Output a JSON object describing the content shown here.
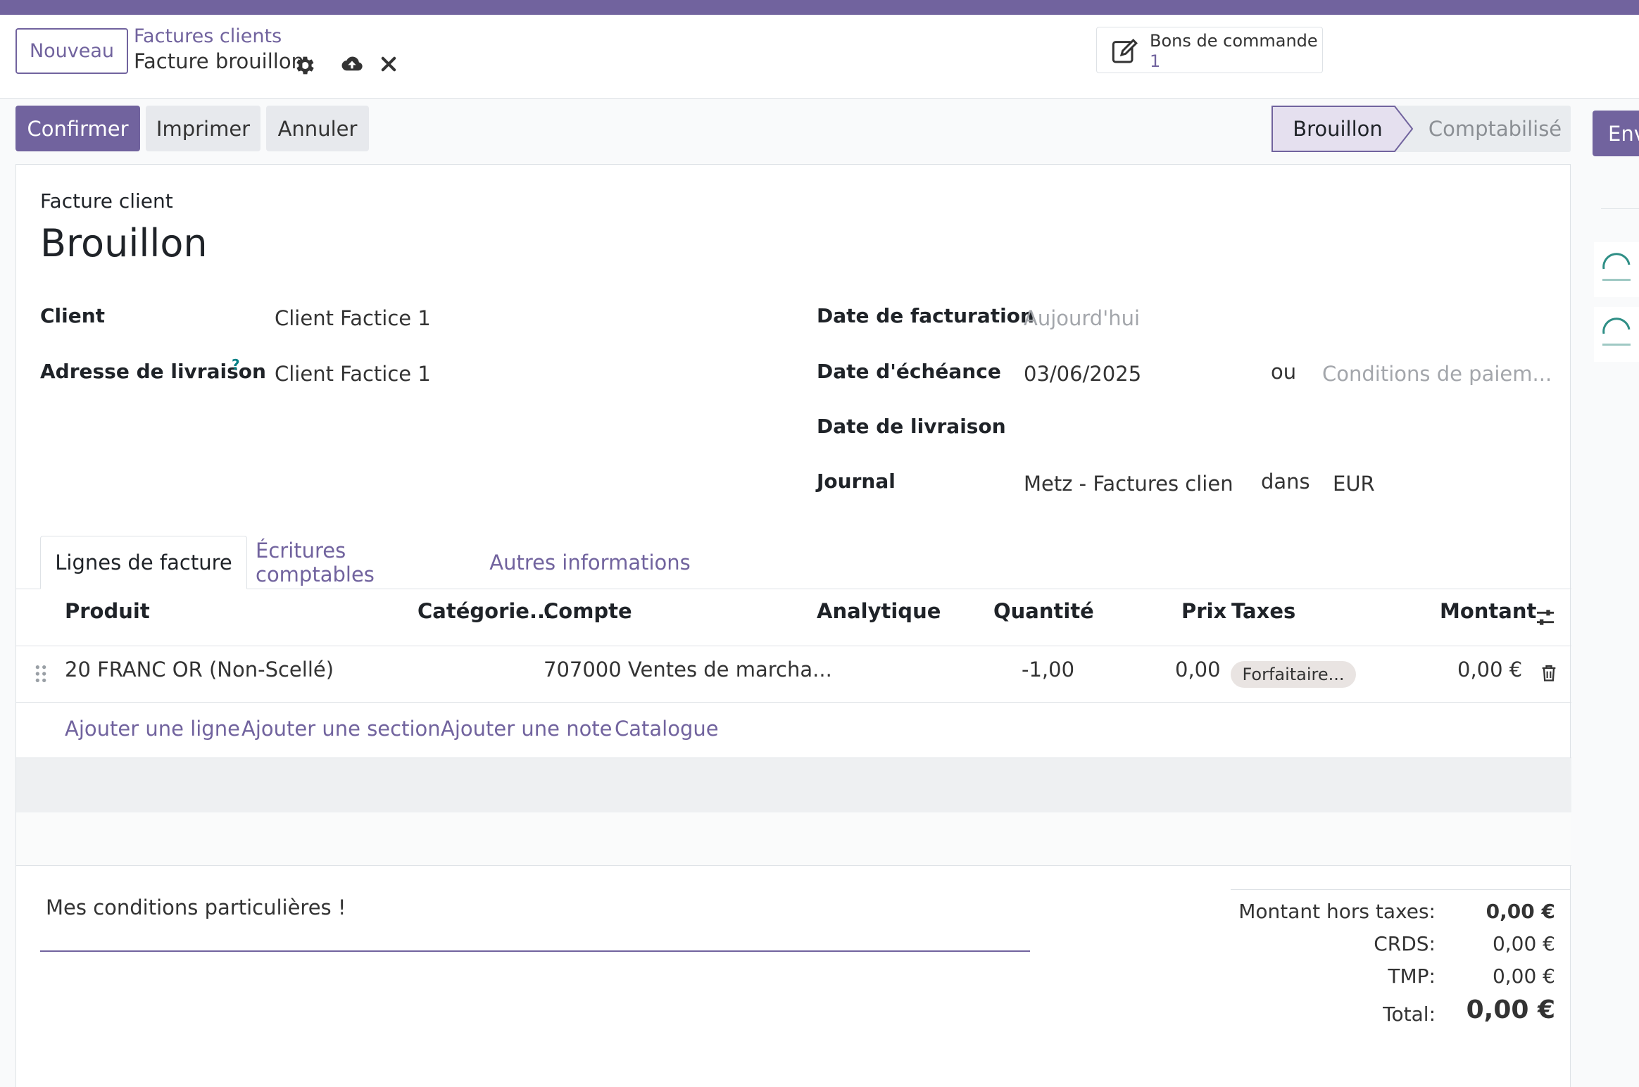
{
  "control_panel": {
    "new_button": "Nouveau",
    "breadcrumb_parent": "Factures clients",
    "breadcrumb_current": "Facture brouillon",
    "smart_button": {
      "label": "Bons de commande",
      "count": "1"
    }
  },
  "statusbar": {
    "confirm": "Confirmer",
    "print": "Imprimer",
    "cancel": "Annuler",
    "stages": [
      "Brouillon",
      "Comptabilisé"
    ],
    "active_stage": "Brouillon",
    "send_partial": "Env"
  },
  "sheet": {
    "type_label": "Facture client",
    "title": "Brouillon",
    "left_fields": {
      "client_label": "Client",
      "client_value": "Client Factice 1",
      "delivery_label": "Adresse de livraison",
      "delivery_help": "?",
      "delivery_value": "Client Factice 1"
    },
    "right_fields": {
      "invoice_date_label": "Date de facturation",
      "invoice_date_placeholder": "Aujourd'hui",
      "due_date_label": "Date d'échéance",
      "due_date_value": "03/06/2025",
      "or_text": "ou",
      "payment_terms_placeholder": "Conditions de paiem...",
      "delivery_date_label": "Date de livraison",
      "journal_label": "Journal",
      "journal_value": "Metz - Factures clien",
      "in_text": "dans",
      "currency": "EUR"
    },
    "tabs": [
      "Lignes de facture",
      "Écritures comptables",
      "Autres informations"
    ],
    "table": {
      "columns": [
        "Produit",
        "Catégorie...",
        "Compte",
        "Analytique",
        "Quantité",
        "Prix",
        "Taxes",
        "Montant"
      ],
      "rows": [
        {
          "product": "20 FRANC OR (Non-Scellé)",
          "category": "",
          "account": "707000 Ventes de marcha...",
          "analytic": "",
          "quantity": "-1,00",
          "price": "0,00",
          "taxes": "Forfaitaire...",
          "amount": "0,00 €"
        }
      ],
      "add_links": [
        "Ajouter une ligne",
        "Ajouter une section",
        "Ajouter une note",
        "Catalogue"
      ]
    },
    "notes": "Mes conditions particulières !",
    "totals": {
      "untaxed_label": "Montant hors taxes:",
      "untaxed_value": "0,00 €",
      "crds_label": "CRDS:",
      "crds_value": "0,00 €",
      "tmp_label": "TMP:",
      "tmp_value": "0,00 €",
      "total_label": "Total:",
      "total_value": "0,00 €"
    }
  },
  "colors": {
    "brand": "#71639e",
    "teal": "#017e84",
    "border": "#dee2e6"
  },
  "icons": [
    "gear-icon",
    "cloud-upload-icon",
    "close-icon",
    "edit-icon",
    "drag-handle-icon",
    "trash-icon",
    "column-settings-icon",
    "avatar-icon"
  ]
}
